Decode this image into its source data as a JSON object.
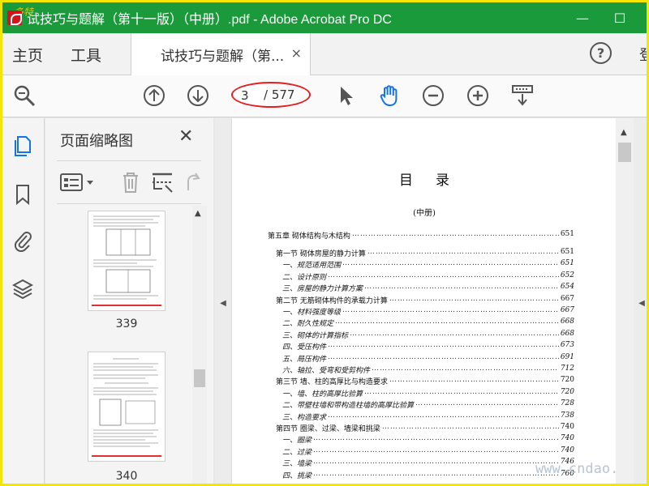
{
  "window": {
    "title": "试技巧与题解（第十一版）（中册）.pdf - Adobe Acrobat Pro DC",
    "minimize": "—",
    "maximize": "☐"
  },
  "tabs": {
    "home": "主页",
    "tools": "工具",
    "doc_tab": "试技巧与题解（第...",
    "close": "×",
    "help": "?",
    "signin": "登"
  },
  "toolbar": {
    "page_current": "3",
    "page_total": "/ 577"
  },
  "thumbnails": {
    "title": "页面缩略图",
    "close": "✕",
    "pages": [
      {
        "label": "339"
      },
      {
        "label": "340"
      }
    ]
  },
  "document": {
    "heading": "目录",
    "subheading": "(中册)",
    "toc": [
      {
        "level": 0,
        "text": "第五章  砌体结构与木结构",
        "page": "651"
      },
      {
        "level": 1,
        "text": "第一节  砌体房屋的静力计算",
        "page": "651"
      },
      {
        "level": 2,
        "text": "一、规范适用范围",
        "page": "651"
      },
      {
        "level": 2,
        "text": "二、设计原则",
        "page": "652"
      },
      {
        "level": 2,
        "text": "三、房屋的静力计算方案",
        "page": "654"
      },
      {
        "level": 1,
        "text": "第二节  无筋砌体构件的承载力计算",
        "page": "667"
      },
      {
        "level": 2,
        "text": "一、材料强度等级",
        "page": "667"
      },
      {
        "level": 2,
        "text": "二、耐久性规定",
        "page": "668"
      },
      {
        "level": 2,
        "text": "三、砌体的计算指标",
        "page": "668"
      },
      {
        "level": 2,
        "text": "四、受压构件",
        "page": "673"
      },
      {
        "level": 2,
        "text": "五、局压构件",
        "page": "691"
      },
      {
        "level": 2,
        "text": "六、轴拉、受弯和受剪构件",
        "page": "712"
      },
      {
        "level": 1,
        "text": "第三节  墙、柱的高厚比与构造要求",
        "page": "720"
      },
      {
        "level": 2,
        "text": "一、墙、柱的高厚比验算",
        "page": "720"
      },
      {
        "level": 2,
        "text": "二、带壁柱墙和带构造柱墙的高厚比验算",
        "page": "728"
      },
      {
        "level": 2,
        "text": "三、构造要求",
        "page": "738"
      },
      {
        "level": 1,
        "text": "第四节  圈梁、过梁、墙梁和挑梁",
        "page": "740"
      },
      {
        "level": 2,
        "text": "一、圈梁",
        "page": "740"
      },
      {
        "level": 2,
        "text": "二、过梁",
        "page": "740"
      },
      {
        "level": 2,
        "text": "三、墙梁",
        "page": "746"
      },
      {
        "level": 2,
        "text": "四、挑梁",
        "page": "760"
      }
    ]
  },
  "watermark": "www.cndao.com",
  "corner_mark": "多特"
}
